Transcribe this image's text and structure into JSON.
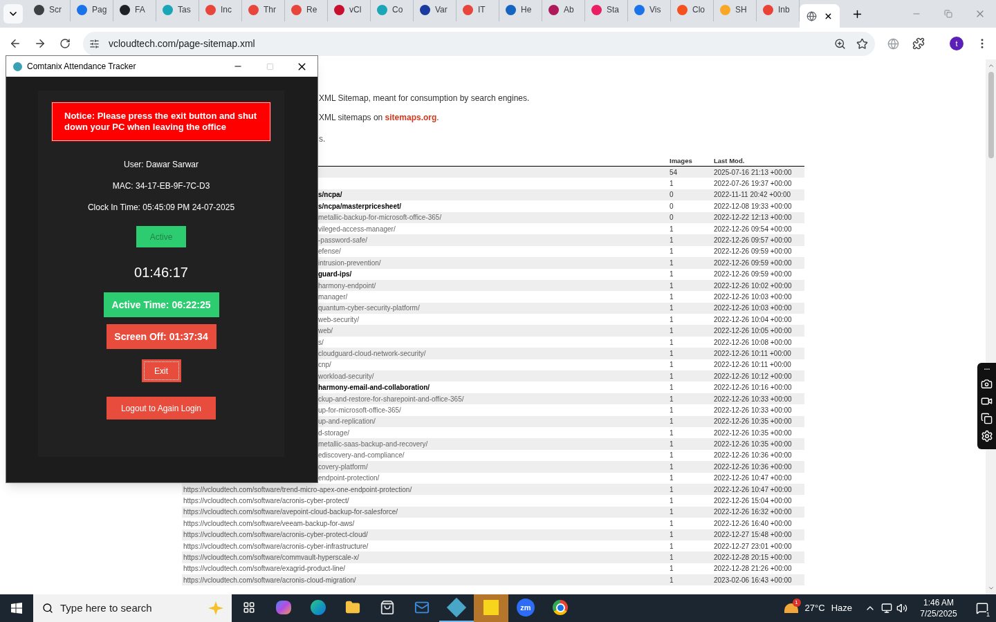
{
  "browser": {
    "tabs": [
      {
        "label": "Scr",
        "color": "#3c4043",
        "selected": false
      },
      {
        "label": "Pag",
        "color": "#1a73e8",
        "selected": false
      },
      {
        "label": "FA",
        "color": "#202124",
        "selected": false
      },
      {
        "label": "Tas",
        "color": "#1aa6b7",
        "selected": false
      },
      {
        "label": "Inc",
        "color": "#e8453c",
        "selected": false
      },
      {
        "label": "Thr",
        "color": "#e8453c",
        "selected": false
      },
      {
        "label": "Re",
        "color": "#e8453c",
        "selected": false
      },
      {
        "label": "vCl",
        "color": "#c8102e",
        "selected": false
      },
      {
        "label": "Co",
        "color": "#1aa6b7",
        "selected": false
      },
      {
        "label": "Var",
        "color": "#1b3aa0",
        "selected": false
      },
      {
        "label": "IT",
        "color": "#e8453c",
        "selected": false
      },
      {
        "label": "He",
        "color": "#1565c0",
        "selected": false
      },
      {
        "label": "Ab",
        "color": "#b0185c",
        "selected": false
      },
      {
        "label": "Sta",
        "color": "#e91e63",
        "selected": false
      },
      {
        "label": "Vis",
        "color": "#1a73e8",
        "selected": false
      },
      {
        "label": "Clo",
        "color": "#f4511e",
        "selected": false
      },
      {
        "label": "SH",
        "color": "#f9a825",
        "selected": false
      },
      {
        "label": "Inb",
        "color": "#ea4335",
        "selected": false
      },
      {
        "color": "#5f6368",
        "selected": true
      }
    ],
    "address": "vcloudtech.com/page-sitemap.xml",
    "profile_initial": "t"
  },
  "page": {
    "intro_1": "XML Sitemap, meant for consumption by search engines.",
    "intro_2": "XML sitemaps on ",
    "intro_2_link": "sitemaps.org",
    "intro_2_end": ".",
    "intro_3": "s.",
    "table": {
      "columns": [
        "Images",
        "Last Mod."
      ],
      "rows_behind_window": [
        {
          "images": "54",
          "last_mod": "2025-07-16 21:13 +00:00"
        },
        {
          "images": "1",
          "last_mod": "2022-07-26 19:37 +00:00"
        },
        {
          "url": "s/ncpa/",
          "images": "0",
          "last_mod": "2022-11-11 20:42 +00:00",
          "emphasis": true
        },
        {
          "url": "s/ncpa/masterpricesheet/",
          "images": "0",
          "last_mod": "2022-12-08 19:33 +00:00",
          "emphasis": true
        },
        {
          "url": "metallic-backup-for-microsoft-office-365/",
          "images": "0",
          "last_mod": "2022-12-22 12:13 +00:00",
          "emphasis": false
        },
        {
          "url": "vileged-access-manager/",
          "images": "1",
          "last_mod": "2022-12-26 09:54 +00:00",
          "emphasis": false
        },
        {
          "url": "-password-safe/",
          "images": "1",
          "last_mod": "2022-12-26 09:57 +00:00",
          "emphasis": false
        },
        {
          "url": "efense/",
          "images": "1",
          "last_mod": "2022-12-26 09:59 +00:00",
          "emphasis": false
        },
        {
          "url": "intrusion-prevention/",
          "images": "1",
          "last_mod": "2022-12-26 09:59 +00:00",
          "emphasis": false
        },
        {
          "url": "guard-ips/",
          "images": "1",
          "last_mod": "2022-12-26 09:59 +00:00",
          "emphasis": true
        },
        {
          "url": "harmony-endpoint/",
          "images": "1",
          "last_mod": "2022-12-26 10:02 +00:00",
          "emphasis": false
        },
        {
          "url": "manager/",
          "images": "1",
          "last_mod": "2022-12-26 10:03 +00:00",
          "emphasis": false
        },
        {
          "url": "quantum-cyber-security-platform/",
          "images": "1",
          "last_mod": "2022-12-26 10:03 +00:00",
          "emphasis": false
        },
        {
          "url": "web-security/",
          "images": "1",
          "last_mod": "2022-12-26 10:04 +00:00",
          "emphasis": false
        },
        {
          "url": "web/",
          "images": "1",
          "last_mod": "2022-12-26 10:05 +00:00",
          "emphasis": false
        },
        {
          "url": "s/",
          "images": "1",
          "last_mod": "2022-12-26 10:08 +00:00",
          "emphasis": false
        },
        {
          "url": "cloudguard-cloud-network-security/",
          "images": "1",
          "last_mod": "2022-12-26 10:11 +00:00",
          "emphasis": false
        },
        {
          "url": "cnp/",
          "images": "1",
          "last_mod": "2022-12-26 10:11 +00:00",
          "emphasis": false
        },
        {
          "url": "workload-security/",
          "images": "1",
          "last_mod": "2022-12-26 10:12 +00:00",
          "emphasis": false
        },
        {
          "url": "harmony-email-and-collaboration/",
          "images": "1",
          "last_mod": "2022-12-26 10:16 +00:00",
          "emphasis": true
        },
        {
          "url": "ckup-and-restore-for-sharepoint-and-office-365/",
          "images": "1",
          "last_mod": "2022-12-26 10:33 +00:00",
          "emphasis": false
        },
        {
          "url": "up-for-microsoft-office-365/",
          "images": "1",
          "last_mod": "2022-12-26 10:33 +00:00",
          "emphasis": false
        },
        {
          "url": "up-and-replication/",
          "images": "1",
          "last_mod": "2022-12-26 10:35 +00:00",
          "emphasis": false
        },
        {
          "url": "d-storage/",
          "images": "1",
          "last_mod": "2022-12-26 10:35 +00:00",
          "emphasis": false
        },
        {
          "url": "metallic-saas-backup-and-recovery/",
          "images": "1",
          "last_mod": "2022-12-26 10:35 +00:00",
          "emphasis": false
        },
        {
          "url": "ediscovery-and-compliance/",
          "images": "1",
          "last_mod": "2022-12-26 10:36 +00:00",
          "emphasis": false
        },
        {
          "url": "covery-platform/",
          "images": "1",
          "last_mod": "2022-12-26 10:36 +00:00",
          "emphasis": false
        },
        {
          "url": "endpoint-protection/",
          "images": "1",
          "last_mod": "2022-12-26 10:47 +00:00",
          "emphasis": false
        }
      ],
      "rows": [
        {
          "url": "https://vcloudtech.com/software/trend-micro-apex-one-endpoint-protection/",
          "images": "1",
          "last_mod": "2022-12-26 10:47 +00:00"
        },
        {
          "url": "https://vcloudtech.com/software/acronis-cyber-protect/",
          "images": "1",
          "last_mod": "2022-12-26 15:04 +00:00"
        },
        {
          "url": "https://vcloudtech.com/software/avepoint-cloud-backup-for-salesforce/",
          "images": "1",
          "last_mod": "2022-12-26 16:32 +00:00"
        },
        {
          "url": "https://vcloudtech.com/software/veeam-backup-for-aws/",
          "images": "1",
          "last_mod": "2022-12-26 16:40 +00:00"
        },
        {
          "url": "https://vcloudtech.com/software/acronis-cyber-protect-cloud/",
          "images": "1",
          "last_mod": "2022-12-27 15:48 +00:00"
        },
        {
          "url": "https://vcloudtech.com/software/acronis-cyber-infrastructure/",
          "images": "1",
          "last_mod": "2022-12-27 23:01 +00:00"
        },
        {
          "url": "https://vcloudtech.com/software/commvault-hyperscale-x/",
          "images": "1",
          "last_mod": "2022-12-28 20:15 +00:00"
        },
        {
          "url": "https://vcloudtech.com/software/exagrid-product-line/",
          "images": "1",
          "last_mod": "2022-12-28 21:26 +00:00"
        },
        {
          "url": "https://vcloudtech.com/software/acronis-cloud-migration/",
          "images": "1",
          "last_mod": "2023-02-06 16:43 +00:00"
        }
      ]
    }
  },
  "app_window": {
    "title": "Comtanix Attendance Tracker",
    "maximize_disabled": true,
    "notice": "Notice: Please press the exit button and shut down your PC when leaving the office",
    "user": "User: Dawar Sarwar",
    "mac": "MAC: 34-17-EB-9F-7C-D3",
    "clock_in": "Clock In Time: 05:45:09 PM 24-07-2025",
    "status_label": "Active",
    "timer": "01:46:17",
    "active_time": "Active Time: 06:22:25",
    "screen_off": "Screen Off: 01:37:34",
    "exit": {
      "label": "Exit",
      "focused": true
    },
    "logout": "Logout to Again Login"
  },
  "taskbar": {
    "search_placeholder": "Type here to search",
    "apps": [
      {
        "kind": "widgets",
        "active": false,
        "attention": false
      },
      {
        "kind": "copilot",
        "active": false,
        "attention": false
      },
      {
        "kind": "edge",
        "active": false,
        "attention": false
      },
      {
        "kind": "folder",
        "active": false,
        "attention": false
      },
      {
        "kind": "store",
        "active": false,
        "attention": false
      },
      {
        "kind": "mail",
        "active": false,
        "attention": false
      },
      {
        "kind": "tracker",
        "active": true,
        "attention": false
      },
      {
        "kind": "notes",
        "active": false,
        "attention": true
      },
      {
        "kind": "zoom",
        "label": "zm",
        "active": false,
        "attention": false
      },
      {
        "kind": "chrome",
        "active": false,
        "attention": false
      }
    ],
    "weather_alert": "1",
    "temperature": "27°C",
    "weather": "Haze",
    "time": "1:46 AM",
    "date": "7/25/2025",
    "notifications": "1"
  }
}
